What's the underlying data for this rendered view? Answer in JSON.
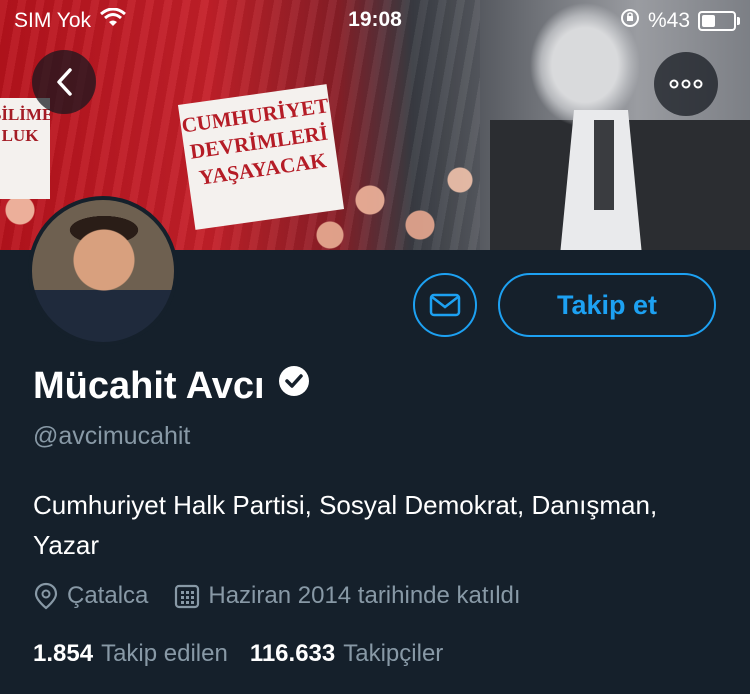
{
  "status_bar": {
    "carrier": "SIM Yok",
    "time": "19:08",
    "battery_percent": "%43",
    "battery_level": 0.43
  },
  "banner": {
    "sign_main": "CUMHURİYET DEVRİMLERİ YAŞAYACAK",
    "sign_left": "BİLİME LUK"
  },
  "profile": {
    "name": "Mücahit Avcı",
    "handle": "@avcimucahit",
    "bio": "Cumhuriyet Halk Partisi, Sosyal Demokrat, Danışman, Yazar",
    "location": "Çatalca",
    "joined": "Haziran 2014 tarihinde katıldı",
    "verified": true
  },
  "actions": {
    "follow_label": "Takip et"
  },
  "stats": {
    "following_count": "1.854",
    "following_label": "Takip edilen",
    "followers_count": "116.633",
    "followers_label": "Takipçiler"
  },
  "colors": {
    "background": "#15202b",
    "accent": "#1da1f2",
    "secondary_text": "#8899a6"
  }
}
